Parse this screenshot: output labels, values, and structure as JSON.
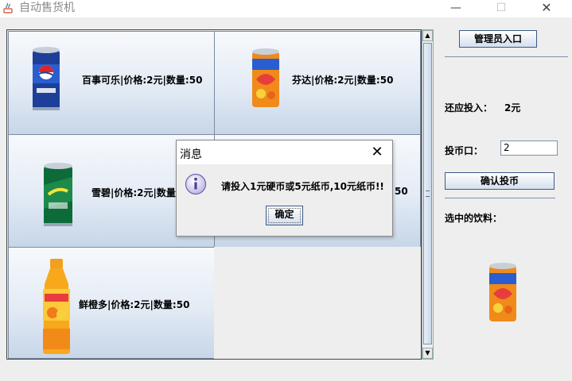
{
  "window": {
    "title": "自动售货机",
    "minimize_glyph": "—",
    "maximize_glyph": "☐",
    "close_glyph": "✕"
  },
  "drinks": [
    {
      "label": "百事可乐|价格:2元|数量:50",
      "icon": "pepsi-can-image"
    },
    {
      "label": "芬达|价格:2元|数量:50",
      "icon": "fanta-can-image"
    },
    {
      "label": "雪碧|价格:2元|数量:50",
      "icon": "sprite-can-image"
    },
    {
      "label": "50",
      "icon": "none"
    },
    {
      "label": "鲜橙多|价格:2元|数量:50",
      "icon": "orange-juice-bottle-image"
    }
  ],
  "sidebar": {
    "admin_button": "管理员入口",
    "remaining_label": "还应投入：",
    "remaining_value": "2元",
    "coin_label": "投币口：",
    "coin_value": "2",
    "confirm_button": "确认投币",
    "selected_label": "选中的饮料："
  },
  "dialog": {
    "title": "消息",
    "message": "请投入1元硬币或5元纸币,10元纸币!!",
    "ok_button": "确定",
    "icon": "info-icon"
  },
  "colors": {
    "cell_gradient_top": "#f7f9fc",
    "cell_gradient_bottom": "#c7d6e8",
    "button_border": "#3c5a86"
  }
}
